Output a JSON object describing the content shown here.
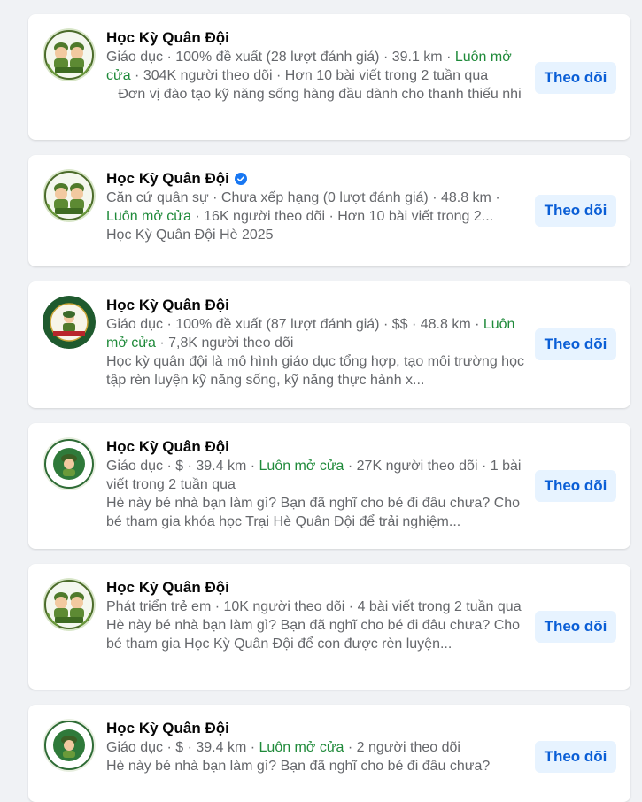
{
  "results": [
    {
      "name": "Học Kỳ Quân Đội",
      "verified": false,
      "avatar_icon": "cartoon-soldiers-icon",
      "meta_a": "Giáo dục · 100% đề xuất (28 lượt đánh giá) · 39.1 km · ",
      "open": "Luôn mở cửa",
      "meta_b": " · 304K người theo dõi · Hơn 10 bài viết trong 2 tuần qua",
      "desc": "   Đơn vị đào tạo kỹ năng sống hàng đầu dành cho thanh thiếu nhi",
      "follow_label": "Theo dõi"
    },
    {
      "name": "Học Kỳ Quân Đội",
      "verified": true,
      "avatar_icon": "cartoon-soldiers-icon",
      "meta_a": "Căn cứ quân sự · Chưa xếp hạng (0 lượt đánh giá) · 48.8 km · ",
      "open": "Luôn mở cửa",
      "meta_b": " · 16K người theo dõi · Hơn 10 bài viết trong 2...",
      "desc": "Học Kỳ Quân Đội Hè 2025",
      "follow_label": "Theo dõi"
    },
    {
      "name": "Học Kỳ Quân Đội",
      "verified": false,
      "avatar_icon": "military-badge-icon",
      "meta_a": "Giáo dục · 100% đề xuất (87 lượt đánh giá) · $$ · 48.8 km · ",
      "open": "Luôn mở cửa",
      "meta_b": " · 7,8K người theo dõi",
      "desc": "Học kỳ quân đội là mô hình giáo dục tổng hợp, tạo môi trường học tập rèn luyện kỹ năng sống, kỹ năng thực hành x...",
      "follow_label": "Theo dõi"
    },
    {
      "name": "Học Kỳ Quân Đội",
      "verified": false,
      "avatar_icon": "soldier-emblem-icon",
      "meta_a": "Giáo dục · $ · 39.4 km · ",
      "open": "Luôn mở cửa",
      "meta_b": " · 27K người theo dõi · 1 bài viết trong 2 tuần qua",
      "desc": "Hè này bé nhà bạn làm gì? Bạn đã nghĩ cho bé đi đâu chưa? Cho bé tham gia khóa học Trại Hè Quân Đội để trải nghiệm...",
      "follow_label": "Theo dõi"
    },
    {
      "name": "Học Kỳ Quân Đội",
      "verified": false,
      "avatar_icon": "cartoon-soldiers-icon",
      "meta_a": "Phát triển trẻ em · 10K người theo dõi · 4 bài viết trong 2 tuần qua",
      "open": "",
      "meta_b": "",
      "desc": "Hè này bé nhà bạn làm gì? Bạn đã nghĩ cho bé đi đâu chưa? Cho bé tham gia Học Kỳ Quân Đội để con được rèn luyện...",
      "follow_label": "Theo dõi"
    },
    {
      "name": "Học Kỳ Quân Đội",
      "verified": false,
      "avatar_icon": "soldier-emblem-icon",
      "meta_a": "Giáo dục · $ · 39.4 km · ",
      "open": "Luôn mở cửa",
      "meta_b": " · 2 người theo dõi",
      "desc": "Hè này bé nhà bạn làm gì? Bạn đã nghĩ cho bé đi đâu chưa?",
      "follow_label": "Theo dõi"
    }
  ],
  "colors": {
    "green_status": "#1f8a3a",
    "follow_bg": "#e7f3ff",
    "follow_text": "#0a5ed6",
    "verified_blue": "#1877f2"
  }
}
